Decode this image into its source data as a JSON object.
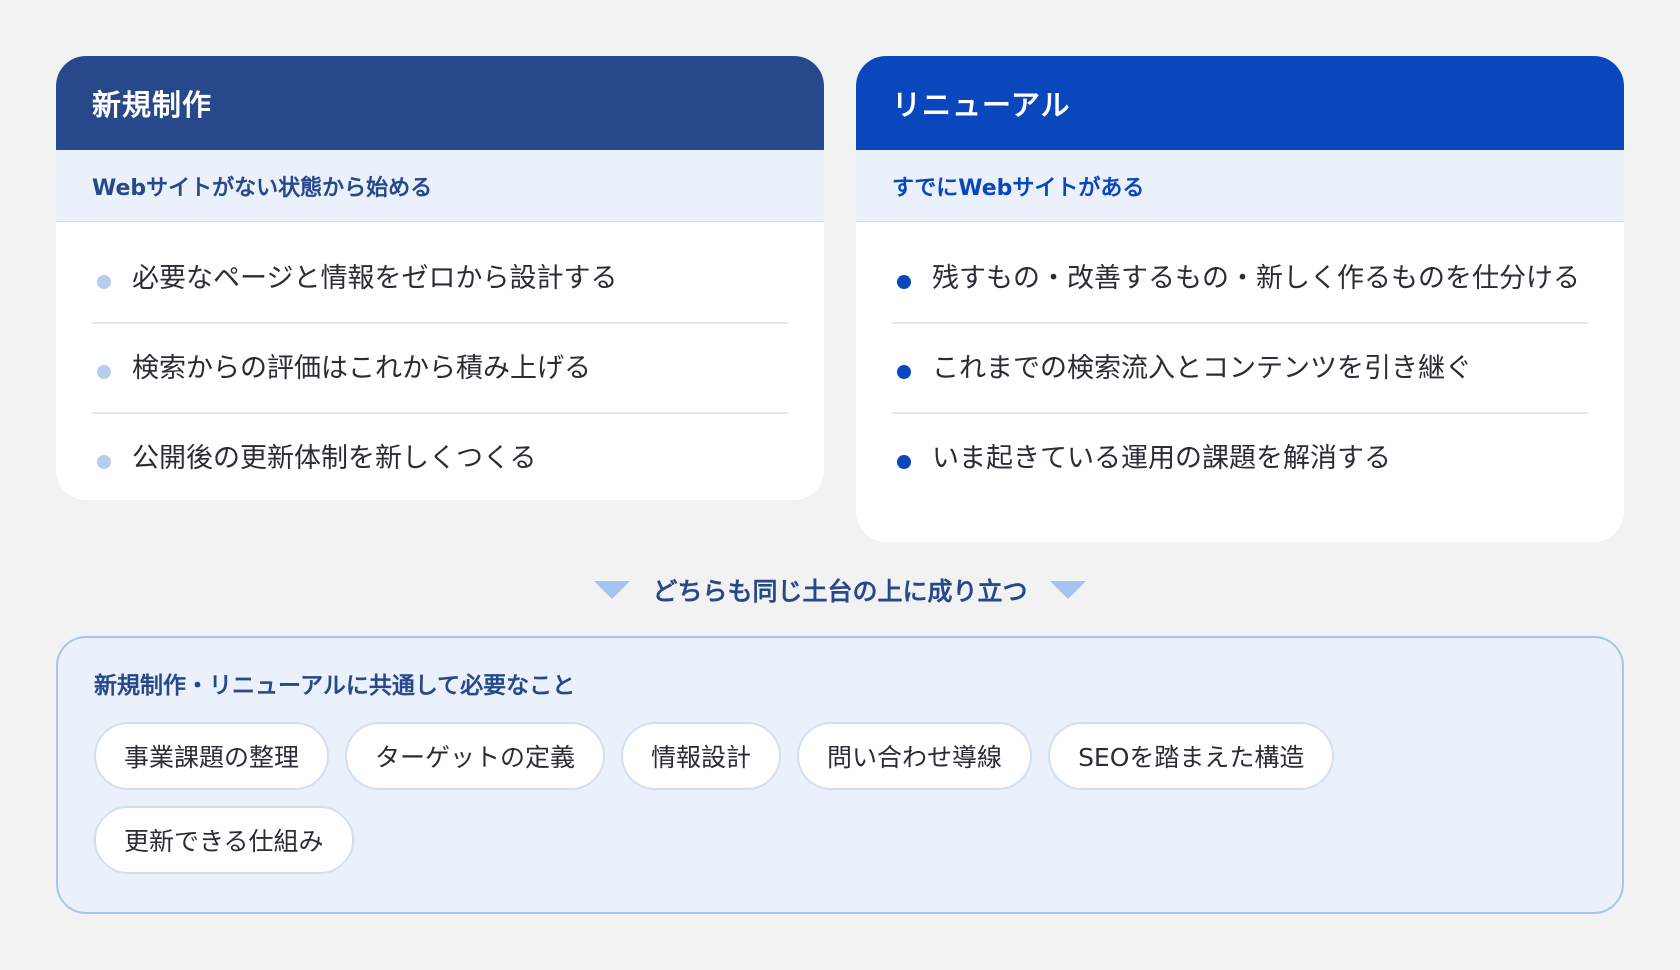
{
  "new_build": {
    "title": "新規制作",
    "subtitle": "Webサイトがない状態から始める",
    "items": [
      "必要なページと情報をゼロから設計する",
      "検索からの評価はこれから積み上げる",
      "公開後の更新体制を新しくつくる"
    ]
  },
  "renewal": {
    "title": "リニューアル",
    "subtitle": "すでにWebサイトがある",
    "items": [
      "残すもの・改善するもの・新しく作るものを仕分ける",
      "これまでの検索流入とコンテンツを引き継ぐ",
      "いま起きている運用の課題を解消する"
    ]
  },
  "connector": {
    "text": "どちらも同じ土台の上に成り立つ"
  },
  "common": {
    "title": "新規制作・リニューアルに共通して必要なこと",
    "chips": [
      "事業課題の整理",
      "ターゲットの定義",
      "情報設計",
      "問い合わせ導線",
      "SEOを踏まえた構造",
      "更新できる仕組み"
    ]
  },
  "colors": {
    "navy": "#27498c",
    "blue": "#0a47bd",
    "light_blue_bg": "#eaf1fb",
    "bullet_light": "#b7cdef"
  }
}
